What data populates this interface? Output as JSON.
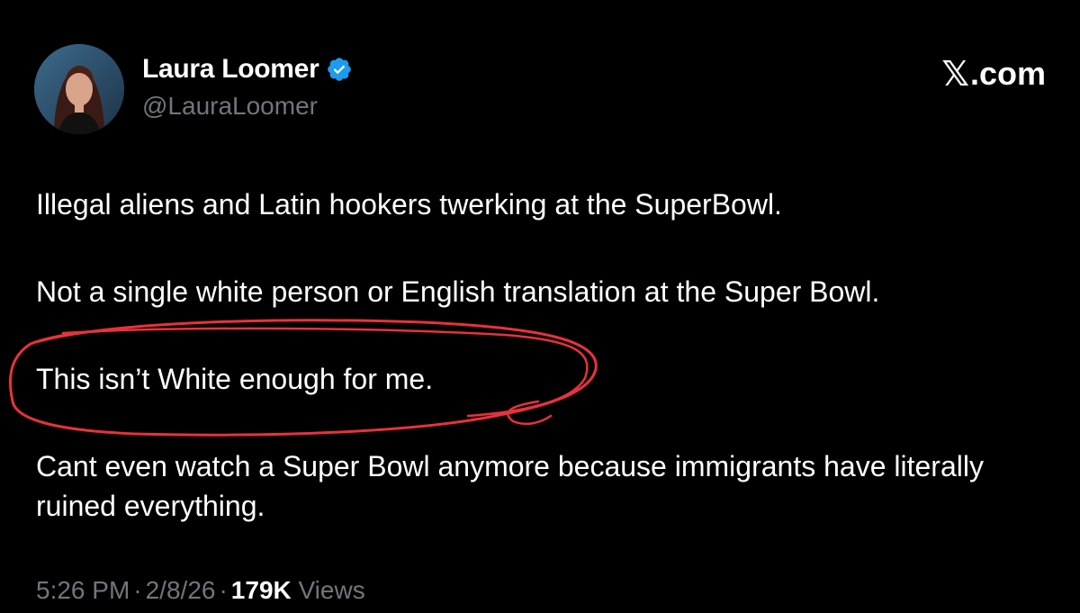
{
  "author": {
    "display_name": "Laura Loomer",
    "handle": "@LauraLoomer",
    "verified": true,
    "verified_color": "#1d9bf0"
  },
  "brand": {
    "x_glyph": "𝕏",
    "domain": ".com"
  },
  "tweet": {
    "paragraphs": [
      "Illegal aliens and Latin hookers twerking at the SuperBowl.",
      "Not a single white person or English translation at the Super Bowl.",
      "This isn’t White enough for me.",
      "Cant even watch a Super Bowl anymore because immigrants have literally ruined everything."
    ]
  },
  "meta": {
    "time": "5:26 PM",
    "separator": "·",
    "date": "2/8/26",
    "views_count": "179K",
    "views_label": "Views"
  },
  "annotation": {
    "color": "#e8323c",
    "icon": "hand-drawn-circle"
  },
  "colors": {
    "background": "#000000",
    "text": "#ffffff",
    "muted": "#71767b"
  }
}
